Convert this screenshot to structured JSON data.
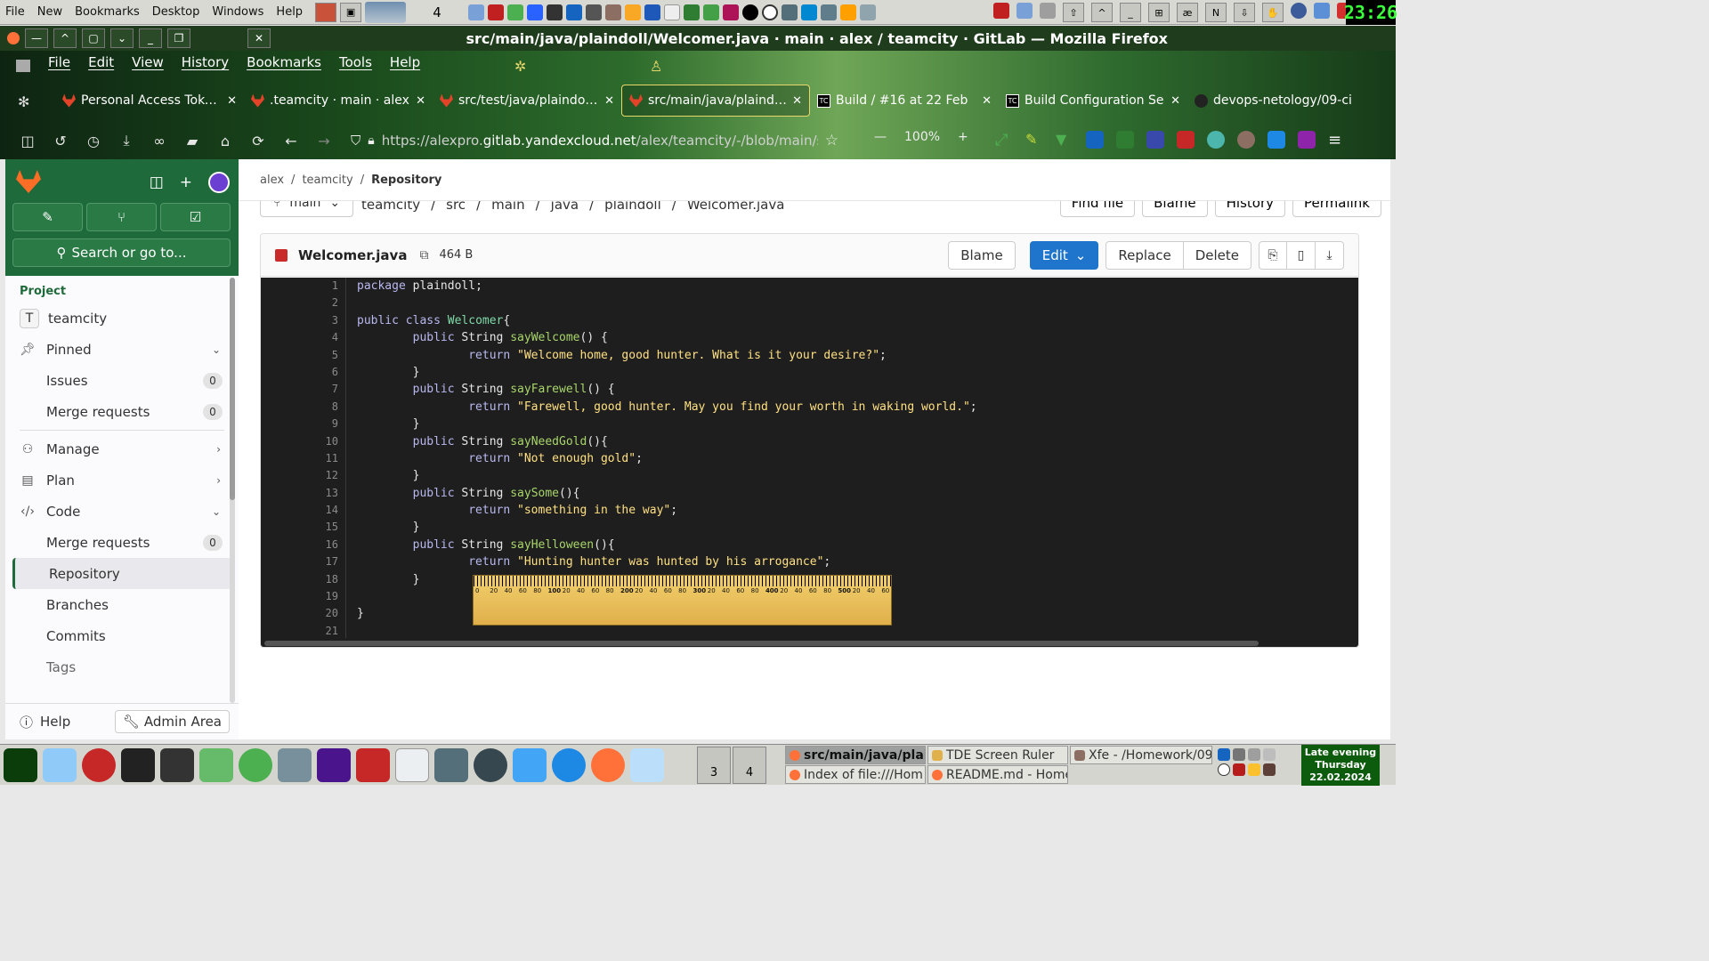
{
  "os_top": {
    "menu": [
      "File",
      "New",
      "Bookmarks",
      "Desktop",
      "Windows",
      "Help"
    ],
    "desktop_number": "4",
    "clock": "23:26"
  },
  "firefox": {
    "window_title": "src/main/java/plaindoll/Welcomer.java · main · alex / teamcity · GitLab — Mozilla Firefox",
    "menu": [
      "File",
      "Edit",
      "View",
      "History",
      "Bookmarks",
      "Tools",
      "Help"
    ],
    "tabs": [
      {
        "label": "Personal Access Tokens",
        "icon": "gitlab-icon",
        "active": false
      },
      {
        "label": ".teamcity · main · alex",
        "icon": "gitlab-icon",
        "active": false
      },
      {
        "label": "src/test/java/plaindoll/W",
        "icon": "gitlab-icon",
        "active": false
      },
      {
        "label": "src/main/java/plaindoll/",
        "icon": "gitlab-icon",
        "active": true
      },
      {
        "label": "Build / #16 at 22 Feb",
        "icon": "teamcity-icon",
        "active": false
      },
      {
        "label": "Build Configuration Se",
        "icon": "teamcity-icon",
        "active": false
      },
      {
        "label": "devops-netology/09-ci",
        "icon": "github-icon",
        "active": false
      }
    ],
    "url_prefix": "https://alexpro.",
    "url_domain": "gitlab.yandexcloud.net",
    "url_rest": "/alex/teamcity/-/blob/main/s",
    "zoom": "100%",
    "zoom_minus": "—",
    "zoom_plus": "+"
  },
  "gitlab": {
    "sidebar": {
      "search_placeholder": "Search or go to...",
      "section": "Project",
      "project_initial": "T",
      "project_name": "teamcity",
      "items": [
        {
          "label": "Pinned",
          "type": "group",
          "chev": "⌄"
        },
        {
          "label": "Issues",
          "type": "sub",
          "badge": "0"
        },
        {
          "label": "Merge requests",
          "type": "sub",
          "badge": "0"
        },
        {
          "label": "Manage",
          "type": "group",
          "chev": "›"
        },
        {
          "label": "Plan",
          "type": "group",
          "chev": "›"
        },
        {
          "label": "Code",
          "type": "group",
          "chev": "⌄"
        },
        {
          "label": "Merge requests",
          "type": "sub",
          "badge": "0"
        },
        {
          "label": "Repository",
          "type": "sub",
          "active": true
        },
        {
          "label": "Branches",
          "type": "sub"
        },
        {
          "label": "Commits",
          "type": "sub"
        },
        {
          "label": "Tags",
          "type": "sub"
        }
      ],
      "help": "Help",
      "admin": "Admin Area"
    },
    "breadcrumb": [
      "alex",
      "teamcity",
      "Repository"
    ],
    "branch": "main",
    "path": [
      "teamcity",
      "/",
      "src",
      "/",
      "main",
      "/",
      "java",
      "/",
      "plaindoll",
      "/",
      "Welcomer.java"
    ],
    "top_buttons": [
      "Find file",
      "Blame",
      "History",
      "Permalink"
    ],
    "file": {
      "name": "Welcomer.java",
      "size": "464 B",
      "buttons": {
        "blame": "Blame",
        "edit": "Edit",
        "replace": "Replace",
        "delete": "Delete"
      }
    },
    "code_lines": [
      "package plaindoll;",
      "",
      "public class Welcomer{",
      "        public String sayWelcome() {",
      "                return \"Welcome home, good hunter. What is it your desire?\";",
      "        }",
      "        public String sayFarewell() {",
      "                return \"Farewell, good hunter. May you find your worth in waking world.\";",
      "        }",
      "        public String sayNeedGold(){",
      "                return \"Not enough gold\";",
      "        }",
      "        public String saySome(){",
      "                return \"something in the way\";",
      "        }",
      "        public String sayHelloween(){",
      "                return \"Hunting hunter was hunted by his arrogance\";",
      "        }",
      "",
      "}",
      ""
    ]
  },
  "ruler": {
    "labels": [
      "0",
      "20",
      "40",
      "60",
      "80",
      "100",
      "20",
      "40",
      "60",
      "80",
      "200",
      "20",
      "40",
      "60",
      "80",
      "300",
      "20",
      "40",
      "60",
      "80",
      "400",
      "20",
      "40",
      "60",
      "80",
      "500",
      "20",
      "40",
      "60"
    ]
  },
  "taskbar": {
    "desktops": [
      "3",
      "4"
    ],
    "tasks": [
      {
        "label": "src/main/java/plai",
        "active": true
      },
      {
        "label": "TDE Screen Ruler",
        "active": false
      },
      {
        "label": "Xfe - /Homework/09",
        "active": false
      },
      {
        "label": "Index of file:///Hom",
        "active": false
      },
      {
        "label": "README.md - Home",
        "active": false
      }
    ],
    "date_lines": [
      "Late evening",
      "Thursday",
      "22.02.2024"
    ]
  }
}
